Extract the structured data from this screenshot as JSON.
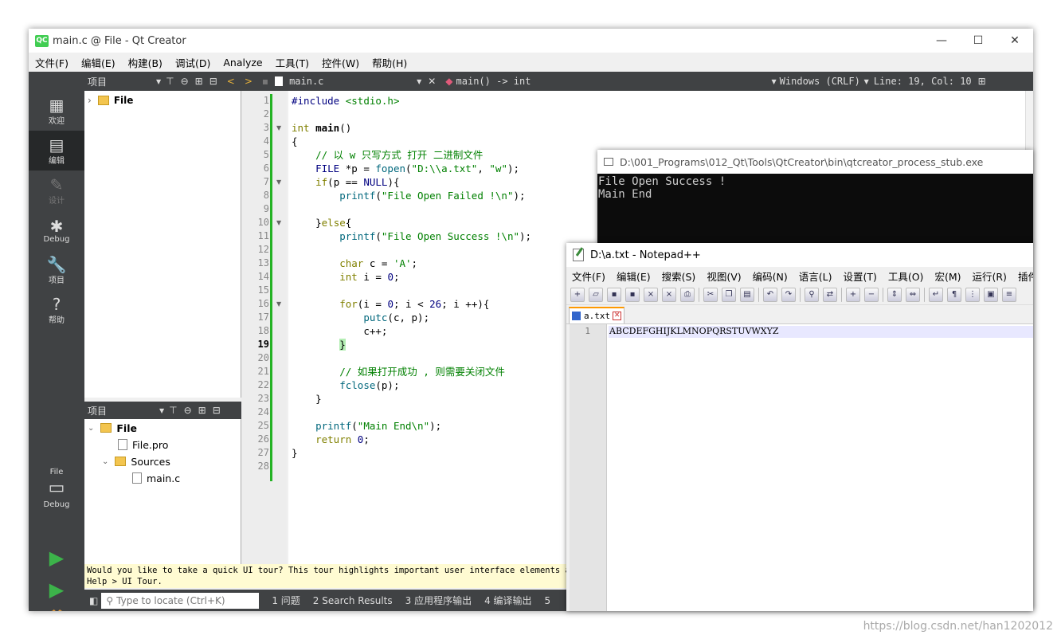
{
  "qt": {
    "title": "main.c @ File - Qt Creator",
    "logo": "QC",
    "menu": [
      "文件(F)",
      "编辑(E)",
      "构建(B)",
      "调试(D)",
      "Analyze",
      "工具(T)",
      "控件(W)",
      "帮助(H)"
    ],
    "window_buttons": [
      "—",
      "☐",
      "✕"
    ],
    "toolbar": {
      "projects_label": "项目",
      "file_name": "main.c",
      "function": "main() -> int",
      "line_ending": "Windows (CRLF)",
      "position": "Line: 19, Col: 10"
    },
    "modes": [
      {
        "label": "欢迎",
        "icon": "grid-icon"
      },
      {
        "label": "编辑",
        "icon": "edit-icon"
      },
      {
        "label": "设计",
        "icon": "pencil-icon"
      },
      {
        "label": "Debug",
        "icon": "bug-icon"
      },
      {
        "label": "项目",
        "icon": "wrench-icon"
      },
      {
        "label": "帮助",
        "icon": "help-icon"
      }
    ],
    "kit": {
      "project": "File",
      "config": "Debug"
    },
    "tree_top": {
      "root": "File"
    },
    "tree_bottom": {
      "header": "项目",
      "root": "File",
      "pro": "File.pro",
      "sources": "Sources",
      "main": "main.c"
    },
    "gutter_lines": [
      "1",
      "2",
      "3",
      "4",
      "5",
      "6",
      "7",
      "8",
      "9",
      "10",
      "11",
      "12",
      "13",
      "14",
      "15",
      "16",
      "17",
      "18",
      "19",
      "20",
      "21",
      "22",
      "23",
      "24",
      "25",
      "26",
      "27",
      "28"
    ],
    "tour": {
      "line1": "Would you like to take a quick UI tour? This tour highlights important user interface elements and sh",
      "line2": "Help > UI Tour."
    },
    "status": {
      "locate_placeholder": "Type to locate (Ctrl+K)",
      "items": [
        "1 问题",
        "2 Search Results",
        "3 应用程序输出",
        "4 编译输出",
        "5"
      ]
    }
  },
  "code": {
    "l1_a": "#include",
    "l1_b": "<stdio.h>",
    "l3_a": "int",
    "l3_b": "main",
    "l3_c": "()",
    "l4": "{",
    "l5": "// 以 w 只写方式 打开 二进制文件",
    "l6_a": "FILE",
    "l6_b": " *p = ",
    "l6_c": "fopen",
    "l6_d": "(",
    "l6_e": "\"D:\\\\a.txt\"",
    "l6_f": ", ",
    "l6_g": "\"w\"",
    "l6_h": ");",
    "l7_a": "if",
    "l7_b": "(p == ",
    "l7_c": "NULL",
    "l7_d": "){",
    "l8_a": "printf",
    "l8_b": "(",
    "l8_c": "\"File Open Failed !\\n\"",
    "l8_d": ");",
    "l10_a": "}",
    "l10_b": "else",
    "l10_c": "{",
    "l11_a": "printf",
    "l11_b": "(",
    "l11_c": "\"File Open Success !\\n\"",
    "l11_d": ");",
    "l13_a": "char",
    "l13_b": " c = ",
    "l13_c": "'A'",
    "l13_d": ";",
    "l14_a": "int",
    "l14_b": " i = ",
    "l14_c": "0",
    "l14_d": ";",
    "l16_a": "for",
    "l16_b": "(i = ",
    "l16_c": "0",
    "l16_d": "; i < ",
    "l16_e": "26",
    "l16_f": "; i ++){",
    "l17_a": "putc",
    "l17_b": "(c, p);",
    "l18": "c++;",
    "l19": "}",
    "l21": "// 如果打开成功 , 则需要关闭文件",
    "l22_a": "fclose",
    "l22_b": "(p);",
    "l23": "}",
    "l25_a": "printf",
    "l25_b": "(",
    "l25_c": "\"Main End\\n\"",
    "l25_d": ");",
    "l26_a": "return",
    "l26_b": " ",
    "l26_c": "0",
    "l26_d": ";",
    "l27": "}"
  },
  "console": {
    "title": "D:\\001_Programs\\012_Qt\\Tools\\QtCreator\\bin\\qtcreator_process_stub.exe",
    "output": [
      "File Open Success !",
      "Main End"
    ]
  },
  "notepad": {
    "title": "D:\\a.txt - Notepad++",
    "menu": [
      "文件(F)",
      "编辑(E)",
      "搜索(S)",
      "视图(V)",
      "编码(N)",
      "语言(L)",
      "设置(T)",
      "工具(O)",
      "宏(M)",
      "运行(R)",
      "插件(P)"
    ],
    "tab": "a.txt",
    "line_no": "1",
    "content": "ABCDEFGHIJKLMNOPQRSTUVWXYZ"
  },
  "watermark": "https://blog.csdn.net/han1202012",
  "colors": {
    "dark_panel": "#404244",
    "change_bar": "#24b324",
    "keyword": "#808000",
    "string": "#008000"
  }
}
